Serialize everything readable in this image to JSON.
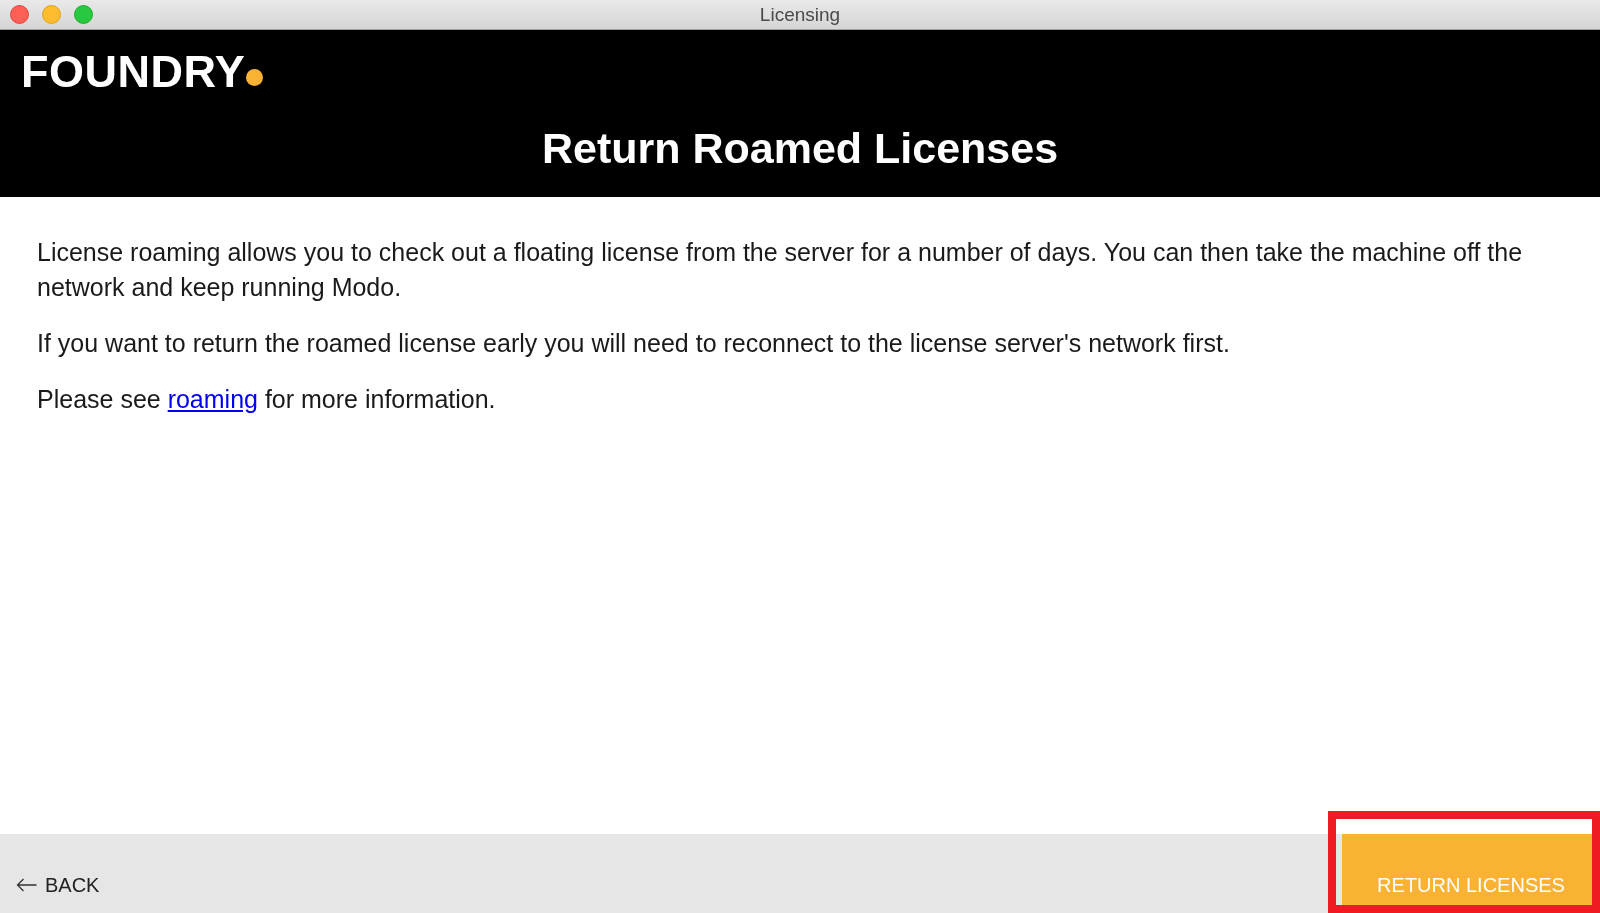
{
  "window": {
    "title": "Licensing"
  },
  "header": {
    "logo": "FOUNDRY",
    "title": "Return Roamed Licenses"
  },
  "content": {
    "paragraphs": [
      {
        "parts": [
          {
            "kind": "text",
            "text": "License roaming allows you to check out a floating license from the server for a number of days. You can then take the machine off the network and keep running Modo."
          }
        ]
      },
      {
        "parts": [
          {
            "kind": "text",
            "text": "If you want to return the roamed license early you will need to reconnect to the license server's network first."
          }
        ]
      },
      {
        "parts": [
          {
            "kind": "text",
            "text": "Please see "
          },
          {
            "kind": "link",
            "text": "roaming"
          },
          {
            "kind": "text",
            "text": " for more information."
          }
        ]
      }
    ]
  },
  "footer": {
    "back_button": {
      "label": "BACK"
    },
    "primary_button": {
      "label": "RETURN LICENSES",
      "highlighted": true
    }
  }
}
